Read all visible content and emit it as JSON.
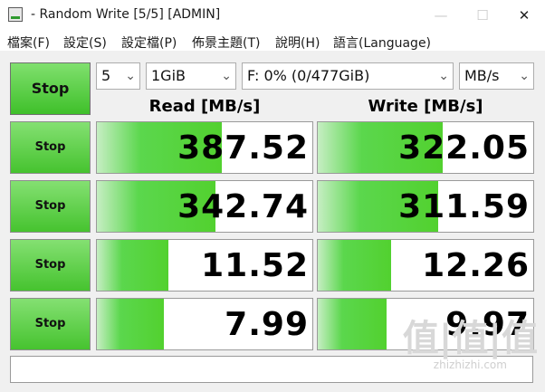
{
  "window": {
    "title": "- Random Write [5/5] [ADMIN]",
    "minimize": "—",
    "maximize": "☐",
    "close": "✕"
  },
  "menu": [
    {
      "label": "檔案(F)"
    },
    {
      "label": "設定(S)"
    },
    {
      "label": "設定檔(P)"
    },
    {
      "label": "佈景主題(T)"
    },
    {
      "label": "說明(H)"
    },
    {
      "label": "語言(Language)"
    }
  ],
  "controls": {
    "all_button": "Stop",
    "count": "5",
    "size": "1GiB",
    "drive": "F: 0% (0/477GiB)",
    "unit": "MB/s"
  },
  "headers": {
    "read": "Read [MB/s]",
    "write": "Write [MB/s]"
  },
  "rows": [
    {
      "button": "Stop",
      "read": "387.52",
      "write": "322.05",
      "read_fill": 0.58,
      "write_fill": 0.58
    },
    {
      "button": "Stop",
      "read": "342.74",
      "write": "311.59",
      "read_fill": 0.55,
      "write_fill": 0.56
    },
    {
      "button": "Stop",
      "read": "11.52",
      "write": "12.26",
      "read_fill": 0.33,
      "write_fill": 0.34
    },
    {
      "button": "Stop",
      "read": "7.99",
      "write": "9.97",
      "read_fill": 0.31,
      "write_fill": 0.32
    }
  ],
  "comment": "",
  "watermark": {
    "logo": "值|值|值",
    "url": "zhizhizhi.com"
  },
  "colors": {
    "button_green": "#46c32f",
    "bar_green": "#52d12f"
  }
}
